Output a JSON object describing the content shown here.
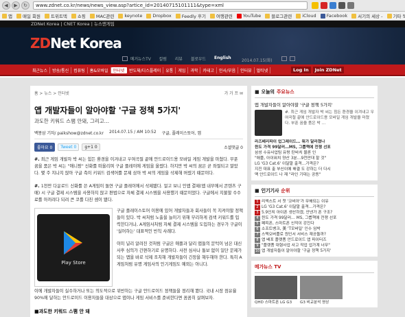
{
  "browser": {
    "url": "www.zdnet.co.kr/news/news_view.asp?artice_id=20140715101111&type=xml",
    "bookmarks": [
      "앱",
      "매일 회원",
      "트위트덱",
      "쇼핑",
      "MAC관련",
      "keynote",
      "Dropbox",
      "Feedly 후기",
      "여행관련",
      "YouTube",
      "블로그관련",
      "iCloud",
      "Facebook",
      "서기의 세상 -",
      "기타 북마크"
    ]
  },
  "site": {
    "topstrip": "ZDNet Korea | CNET Korea | 뉴스앤게임",
    "logo_zd": "ZD",
    "logo_rest": "Net Korea",
    "menu": [
      "메거뉴스TV",
      "칼럼",
      "리뷰",
      "블로우드",
      "English"
    ],
    "date": "2014.07.15(화)",
    "rednav": [
      "최근뉴스",
      "방송/통신",
      "컴퓨팅",
      "홈&모바일",
      "인터넷",
      "반도체/디스플레이",
      "유통",
      "게임",
      "과학",
      "카테고",
      "인사/부음",
      "인터뷰",
      "멀티넷"
    ],
    "login": [
      "Log In",
      "Join ZDNet"
    ]
  },
  "article": {
    "breadcrumb": "홈 > 뉴스 > 인터넷",
    "tools": "가 가 프 ✉",
    "title": "앱 개발자들이 알아야할 '구글 정책 5가지'",
    "subtitle": "과도한 키워드 스팸 안돼, 그리고…",
    "author": "백봉삼 기자/ paikshow@zdnet.co.kr",
    "date": "2014.07.15 / AM 10:52",
    "tags": "구글, 플레이스토어, 앱",
    "fb_label": "좋아요 0",
    "tw_label": "Tweet 0",
    "g_label": "g+1 0",
    "subscribe": "소셜댓글 0",
    "para1_lead": "#.",
    "para1": "최근 게임 개발자 박 씨는 힘든 환경을 이겨내고 우여곡절 끝에 안드로이드용 모바일 게임 개발을 마쳤다. 부푼 꿈을 품은 박 씨는 \"애니팡\" 신화를 떠올리며 구글 플레이에 게임을 올렸다. 하지만 박 씨의 꿈은 곧 좌절되고 말았다. 몇 주 지나지 않아 구글 측이 키워드 검색어를 문제 삼아 박 씨의 게임을 삭제해 버렸기 때문이다.",
    "para2_lead": "#.",
    "para2": "1천만 다운로드 신화를 쓴 A게임이 돌연 구글 플레이에서 삭제됐다. 얼고 보니 인앱 결제(앱 내부에서 콘텐츠 구매) 시 구글 결제 시스템을 사용하지 않고 편법으로 자체 결제 시스템을 사용했기 때문이었다. 구글에서 지불할 수수료를 아끼려다 되려 큰 코를 다친 셈이 됐다.",
    "figure_caption": "Play Store",
    "para3": "구글 플레이스토어 이용에 있어 개발자들과 회사들이 꼭 지켜야할 정책들이 있다. 박 씨처럼 노출을 늘이기 위해 무리하게 검색 키워드를 입력한다거나, A게임사처럼 자체 결제 시스템을 도입하는 경우가 구글이 '실어하는' 대표적인 반칙 사례다.",
    "para4": "이미 널리 알려진 것처럼 구글은 애플과 달리 앱들의 문턱이 넘은 대신 사후 심의가 간편하기로 유명하다. 사전 심사나 통보 없이 일단 문제가 되는 앱을 바로 삭제 조치해 개발자들이 긴장을 해두해야 한다. 특히 A게임처럼 유명 게임사의 인기게임도 예외는 아니다.",
    "para5": "이에 개발자들이 실수하거나 또는 의도적으로 위반하는 구글 안드로이드 정책들을 정리해 봤다. 국내 시장 점유율 90%에 달하는 안드로이드 이용자들을 대상으로 앱이나 게임 서비스를 준비한다면 꼼꼼히 살펴보자.",
    "section": "■과도한 키워드 스팸 안 돼"
  },
  "sidebar": {
    "highlight": {
      "header_prefix": "오늘의",
      "header_red": "주요뉴스",
      "title": "앱 개발자들이 알아야할 '구글 정책 5가지'",
      "desc": "#. 최근 게임 개발자 박 씨는 힘든 환경을 이겨내고 우여곡절 끝에 안드로이드용 모바일 게임 개발을 마쳤다. 부푼 꿈을 품은 박 ..."
    },
    "news": [
      "라즈베리파이 업그레이드… 뭐가 달라졌나",
      "윈도 가격 99달러…MS, 그룹핵에 전쟁 선포",
      "삼성 수유사업팀 유랑 탄바치 물론 인",
      "\"애플, 아이워치 양산 3분…9천만대 할 것\"",
      "LG 'G3 Cat.6' 이달말 출격…가격은?",
      "지진 대표 출 부신이에 해결 도 강하는 더 다시",
      "맥 안드로이드 나 재 \"라인 기대는 공동\""
    ],
    "popular_header_prefix": "인기기사",
    "popular_header_red": "순위",
    "popular": [
      "리액스트 서 첫 '코비아'가 무해되는 이유",
      "LG 'G3 Cat.6' 이달말 출격…가격은?",
      "5.9인치 아이폰 생산하겠, 안넨가 폰 구조?",
      "윈도 가격 99달러… MS, 그룹핵에 전쟁 선포",
      "페피폰, 스마트폰 신작이 강진다",
      "소프트뱅크, 美 'T모바일' 인수 임박",
      "스택오버플로 원인서 서비스 재공돌까?",
      "앱 배포 플랫폼 안드로이드 앱 파이터즈",
      "\"플랫폼 대형사업 사고 작업 업가계 너무\"",
      "앱 개발자들이 알아야할 '구글 정책 5가지'"
    ],
    "tv_header": "메가뉴스 TV",
    "tv": [
      "QHD 스마트폰 LG G3",
      "G3 비교분석 영상"
    ]
  }
}
